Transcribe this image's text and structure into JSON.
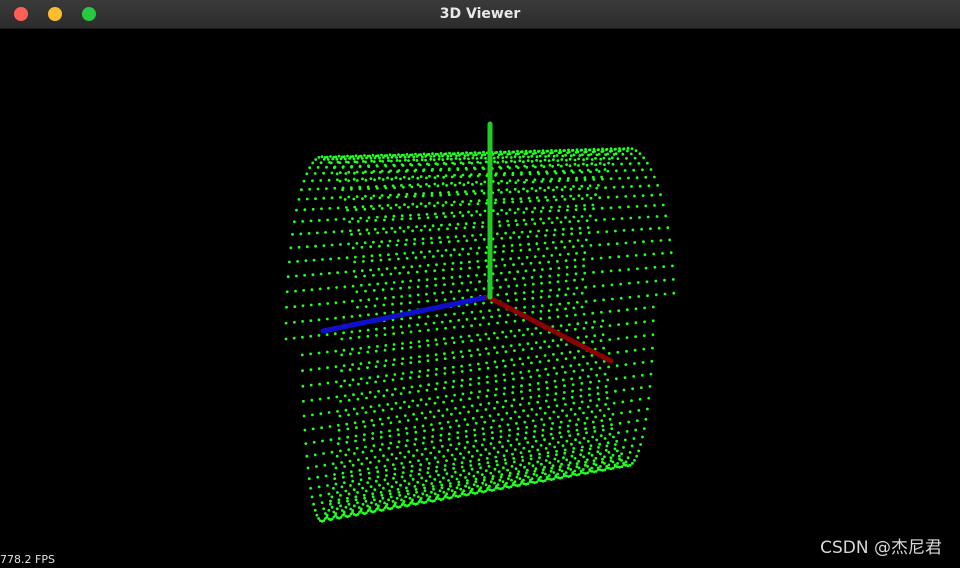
{
  "window": {
    "title": "3D Viewer",
    "controls": {
      "close": "close-icon",
      "minimize": "minimize-icon",
      "maximize": "maximize-icon"
    }
  },
  "viewport": {
    "background": "#000000",
    "point_color": "#22ff22",
    "axes": {
      "x_color": "#8b0000",
      "y_color": "#22cc22",
      "z_color": "#1010cc"
    }
  },
  "status": {
    "fps": "778.2 FPS"
  },
  "watermark": {
    "text": "CSDN @杰尼君"
  }
}
